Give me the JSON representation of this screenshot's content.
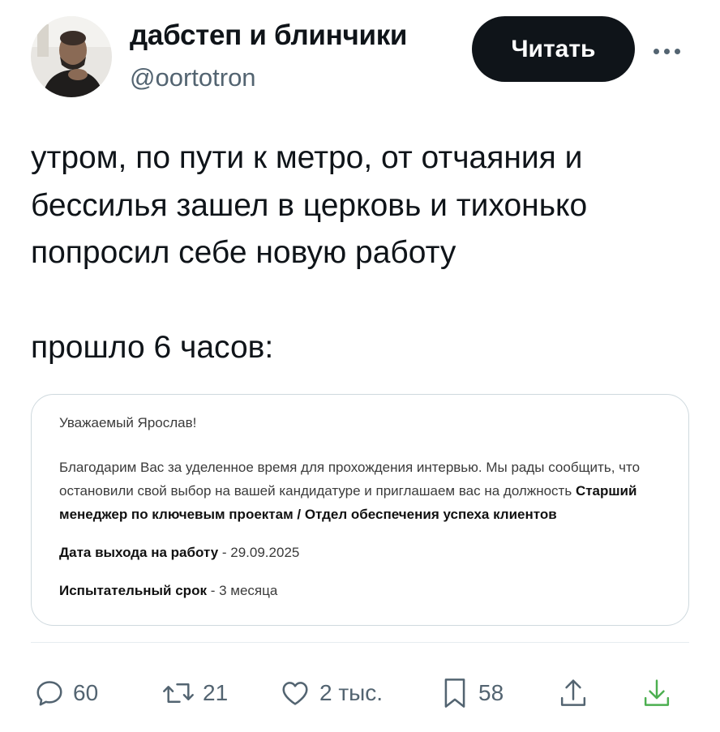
{
  "author": {
    "display_name": "дабстеп и блинчики",
    "handle": "@oortotron"
  },
  "follow_button": {
    "label": "Читать"
  },
  "more_menu": {
    "icon": "more-horizontal-icon"
  },
  "tweet": {
    "paragraph_1": "утром, по пути к метро, от отчаяния и бессилья зашел в церковь и тихонько попросил себе новую работу",
    "paragraph_2": "прошло 6 часов:"
  },
  "attached_image": {
    "greeting": "Уважаемый Ярослав!",
    "body_intro": "Благодарим Вас за уделенное время для прохождения интервью. Мы рады сообщить, что остановили свой выбор на вашей кандидатуре и приглашаем вас на должность ",
    "position_title": "Старший менеджер по ключевым проектам / Отдел обеспечения успеха клиентов",
    "start_date_label": "Дата выхода на работу",
    "start_date_value": " - 29.09.2025",
    "probation_label": "Испытательный срок",
    "probation_value": " - 3 месяца"
  },
  "actions": {
    "replies": {
      "icon": "reply-icon",
      "count": "60"
    },
    "reposts": {
      "icon": "repost-icon",
      "count": "21"
    },
    "likes": {
      "icon": "heart-icon",
      "count": "2 тыс."
    },
    "bookmarks": {
      "icon": "bookmark-icon",
      "count": "58"
    },
    "share": {
      "icon": "share-icon"
    },
    "download": {
      "icon": "download-icon",
      "color": "#4caf50"
    }
  },
  "colors": {
    "text_primary": "#0f1419",
    "text_secondary": "#536471",
    "button_bg": "#0f1419",
    "border": "#cfd9de"
  }
}
